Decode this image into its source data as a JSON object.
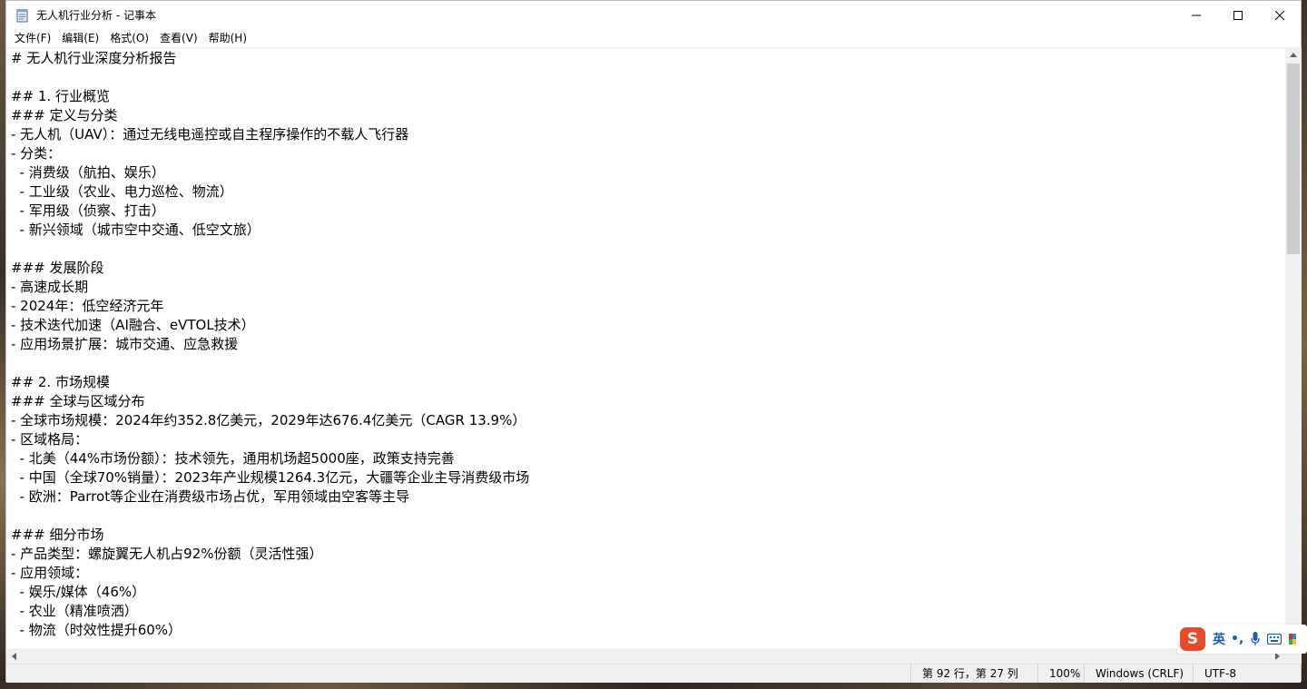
{
  "window": {
    "title": "无人机行业分析 - 记事本"
  },
  "menu": {
    "items": [
      "文件(F)",
      "编辑(E)",
      "格式(O)",
      "查看(V)",
      "帮助(H)"
    ]
  },
  "editor": {
    "lines": [
      "# 无人机行业深度分析报告",
      "",
      "## 1. 行业概览",
      "### 定义与分类",
      "- 无人机（UAV）：通过无线电遥控或自主程序操作的不载人飞行器",
      "- 分类：",
      "  - 消费级（航拍、娱乐）",
      "  - 工业级（农业、电力巡检、物流）",
      "  - 军用级（侦察、打击）",
      "  - 新兴领域（城市空中交通、低空文旅）",
      "",
      "### 发展阶段",
      "- 高速成长期",
      "- 2024年：低空经济元年",
      "- 技术迭代加速（AI融合、eVTOL技术）",
      "- 应用场景扩展：城市交通、应急救援",
      "",
      "## 2. 市场规模",
      "### 全球与区域分布",
      "- 全球市场规模：2024年约352.8亿美元，2029年达676.4亿美元（CAGR 13.9%）",
      "- 区域格局：",
      "  - 北美（44%市场份额）：技术领先，通用机场超5000座，政策支持完善",
      "  - 中国（全球70%销量）：2023年产业规模1264.3亿元，大疆等企业主导消费级市场",
      "  - 欧洲：Parrot等企业在消费级市场占优，军用领域由空客等主导",
      "",
      "### 细分市场",
      "- 产品类型：螺旋翼无人机占92%份额（灵活性强）",
      "- 应用领域：",
      "  - 娱乐/媒体（46%）",
      "  - 农业（精准喷洒）",
      "  - 物流（时效性提升60%）"
    ]
  },
  "status": {
    "position": "第 92 行，第 27 列",
    "zoom": "100%",
    "line_ending": "Windows (CRLF)",
    "encoding": "UTF-8"
  },
  "ime": {
    "logo": "S",
    "mode": "英",
    "punct": "•,"
  }
}
